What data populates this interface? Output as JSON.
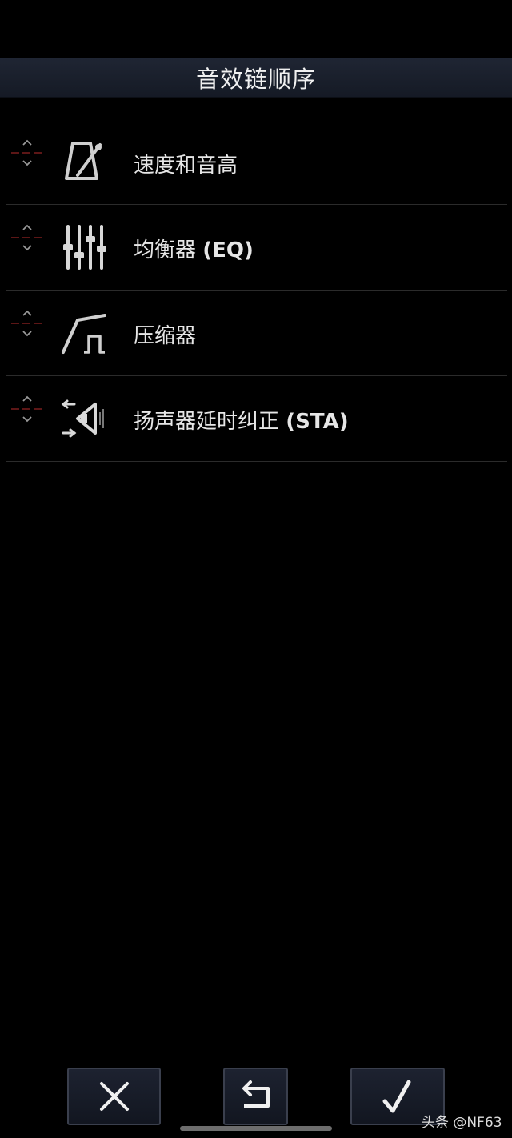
{
  "header": {
    "title": "音效链顺序"
  },
  "items": [
    {
      "label": "速度和音高",
      "label_en": "",
      "icon": "metronome-icon"
    },
    {
      "label": "均衡器",
      "label_en": "(EQ)",
      "icon": "equalizer-sliders-icon"
    },
    {
      "label": "压缩器",
      "label_en": "",
      "icon": "compressor-curve-icon"
    },
    {
      "label": "扬声器延时纠正",
      "label_en": "(STA)",
      "icon": "speaker-delay-icon"
    }
  ],
  "footer": {
    "cancel_icon": "close-icon",
    "undo_icon": "undo-icon",
    "confirm_icon": "checkmark-icon"
  },
  "watermark": "头条 @NF63",
  "colors": {
    "background": "#000000",
    "title_bar": "#1b2130",
    "divider": "#2b2b2b",
    "handle_line": "#7a1e1e"
  }
}
